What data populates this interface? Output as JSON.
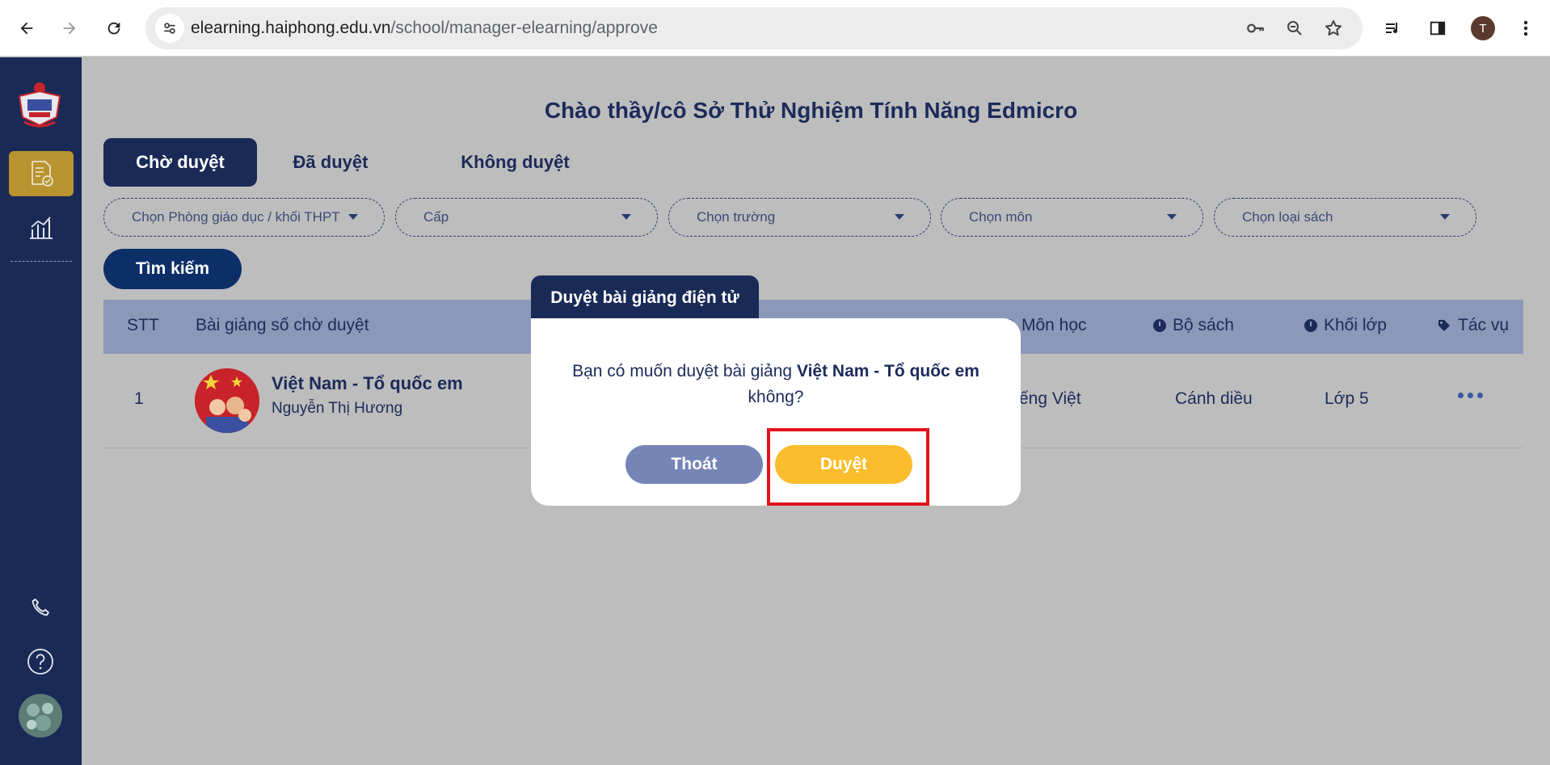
{
  "browser": {
    "url_host": "elearning.haiphong.edu.vn",
    "url_path": "/school/manager-elearning/approve",
    "profile_initial": "T"
  },
  "greeting": "Chào thầy/cô Sở Thử Nghiệm Tính Năng Edmicro",
  "tabs": [
    "Chờ duyệt",
    "Đã duyệt",
    "Không duyệt"
  ],
  "filters": [
    "Chọn Phòng giáo dục / khối THPT",
    "Cấp",
    "Chọn trường",
    "Chọn môn",
    "Chọn loại sách"
  ],
  "search_label": "Tìm kiếm",
  "table": {
    "headers": {
      "stt": "STT",
      "lesson": "Bài giảng số chờ duyệt",
      "subject": "Môn học",
      "book": "Bộ sách",
      "grade": "Khối lớp",
      "action": "Tác vụ"
    },
    "rows": [
      {
        "stt": "1",
        "title": "Việt Nam - Tổ quốc em",
        "author": "Nguyễn Thị Hương",
        "subject": "ếng Việt",
        "book": "Cánh diều",
        "grade": "Lớp 5"
      }
    ]
  },
  "modal": {
    "title": "Duyệt bài giảng điện tử",
    "msg_before": "Bạn có muốn duyệt bài giảng ",
    "msg_bold": "Việt Nam - Tổ quốc em",
    "msg_after": "không?",
    "cancel_label": "Thoát",
    "confirm_label": "Duyệt"
  },
  "colors": {
    "sidebar": "#1a2a57",
    "active_side": "#b8932e",
    "primary_text": "#1c2b5a",
    "approve": "#fbbd2c",
    "exit": "#7585b6",
    "highlight": "#e3141b"
  },
  "icons": {
    "back": "arrow-left-icon",
    "forward": "arrow-right-icon",
    "reload": "reload-icon",
    "site_info": "tune-icon",
    "key": "key-icon",
    "zoom": "zoom-out-icon",
    "bookmark": "star-icon",
    "media": "media-queue-icon",
    "side_panel": "side-panel-icon",
    "menu": "kebab-menu-icon",
    "doc_check": "document-check-icon",
    "chart": "chart-icon",
    "phone": "phone-icon",
    "help": "question-icon"
  }
}
